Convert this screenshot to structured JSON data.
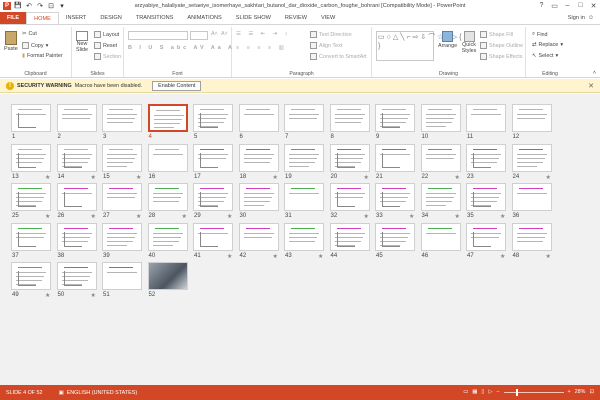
{
  "window": {
    "title": "arzyabiye_halaliyate_setaeiye_isomerhaye_sakhtari_butanol_dar_dioxide_carbon_foughe_bohrani [Compatibility Mode] - PowerPoint",
    "controls": [
      "?",
      "▭",
      "–",
      "□",
      "✕"
    ]
  },
  "qat": {
    "save": "💾",
    "undo": "↶",
    "redo": "↷",
    "present": "⊡",
    "customize": "▾"
  },
  "tabs": [
    "FILE",
    "HOME",
    "INSERT",
    "DESIGN",
    "TRANSITIONS",
    "ANIMATIONS",
    "SLIDE SHOW",
    "REVIEW",
    "VIEW"
  ],
  "active_tab": "HOME",
  "signin": "Sign in",
  "ribbon": {
    "clipboard": {
      "label": "Clipboard",
      "paste": "Paste",
      "cut": "Cut",
      "copy": "Copy",
      "format_painter": "Format Painter"
    },
    "slides": {
      "label": "Slides",
      "new_slide": "New Slide",
      "layout": "Layout",
      "reset": "Reset",
      "section": "Section"
    },
    "font": {
      "label": "Font"
    },
    "paragraph": {
      "label": "Paragraph",
      "text_direction": "Text Direction",
      "align_text": "Align Text",
      "convert": "Convert to SmartArt"
    },
    "drawing": {
      "label": "Drawing",
      "arrange": "Arrange",
      "quick_styles": "Quick Styles",
      "shape_fill": "Shape Fill",
      "shape_outline": "Shape Outline",
      "shape_effects": "Shape Effects"
    },
    "editing": {
      "label": "Editing",
      "find": "Find",
      "replace": "Replace",
      "select": "Select"
    }
  },
  "security_bar": {
    "title": "SECURITY WARNING",
    "message": "Macros have been disabled.",
    "button": "Enable Content",
    "close": "✕"
  },
  "slides": [
    {
      "num": "1",
      "star": false
    },
    {
      "num": "2",
      "star": false
    },
    {
      "num": "3",
      "star": false
    },
    {
      "num": "4",
      "star": false,
      "selected": true
    },
    {
      "num": "5",
      "star": false
    },
    {
      "num": "6",
      "star": false
    },
    {
      "num": "7",
      "star": false
    },
    {
      "num": "8",
      "star": false
    },
    {
      "num": "9",
      "star": false
    },
    {
      "num": "10",
      "star": false
    },
    {
      "num": "11",
      "star": false
    },
    {
      "num": "12",
      "star": false
    },
    {
      "num": "13",
      "star": true
    },
    {
      "num": "14",
      "star": true
    },
    {
      "num": "15",
      "star": true
    },
    {
      "num": "16",
      "star": false
    },
    {
      "num": "17",
      "star": false
    },
    {
      "num": "18",
      "star": true
    },
    {
      "num": "19",
      "star": false
    },
    {
      "num": "20",
      "star": true
    },
    {
      "num": "21",
      "star": false
    },
    {
      "num": "22",
      "star": true
    },
    {
      "num": "23",
      "star": false
    },
    {
      "num": "24",
      "star": true
    },
    {
      "num": "25",
      "star": true
    },
    {
      "num": "26",
      "star": true
    },
    {
      "num": "27",
      "star": true
    },
    {
      "num": "28",
      "star": true
    },
    {
      "num": "29",
      "star": true
    },
    {
      "num": "30",
      "star": false
    },
    {
      "num": "31",
      "star": false
    },
    {
      "num": "32",
      "star": true
    },
    {
      "num": "33",
      "star": true
    },
    {
      "num": "34",
      "star": true
    },
    {
      "num": "35",
      "star": true
    },
    {
      "num": "36",
      "star": false
    },
    {
      "num": "37",
      "star": false
    },
    {
      "num": "38",
      "star": false
    },
    {
      "num": "39",
      "star": false
    },
    {
      "num": "40",
      "star": false
    },
    {
      "num": "41",
      "star": true
    },
    {
      "num": "42",
      "star": true
    },
    {
      "num": "43",
      "star": true
    },
    {
      "num": "44",
      "star": false
    },
    {
      "num": "45",
      "star": false
    },
    {
      "num": "46",
      "star": false
    },
    {
      "num": "47",
      "star": true
    },
    {
      "num": "48",
      "star": true
    },
    {
      "num": "49",
      "star": true
    },
    {
      "num": "50",
      "star": true
    },
    {
      "num": "51",
      "star": false
    },
    {
      "num": "52",
      "star": false,
      "picture": true
    }
  ],
  "statusbar": {
    "slide": "SLIDE 4 OF 52",
    "language": "ENGLISH (UNITED STATES)",
    "zoom": "28%"
  },
  "colors": {
    "accent": "#d24726",
    "warning_bg": "#fff4ce",
    "sorter_bg": "#f1f1f1"
  }
}
